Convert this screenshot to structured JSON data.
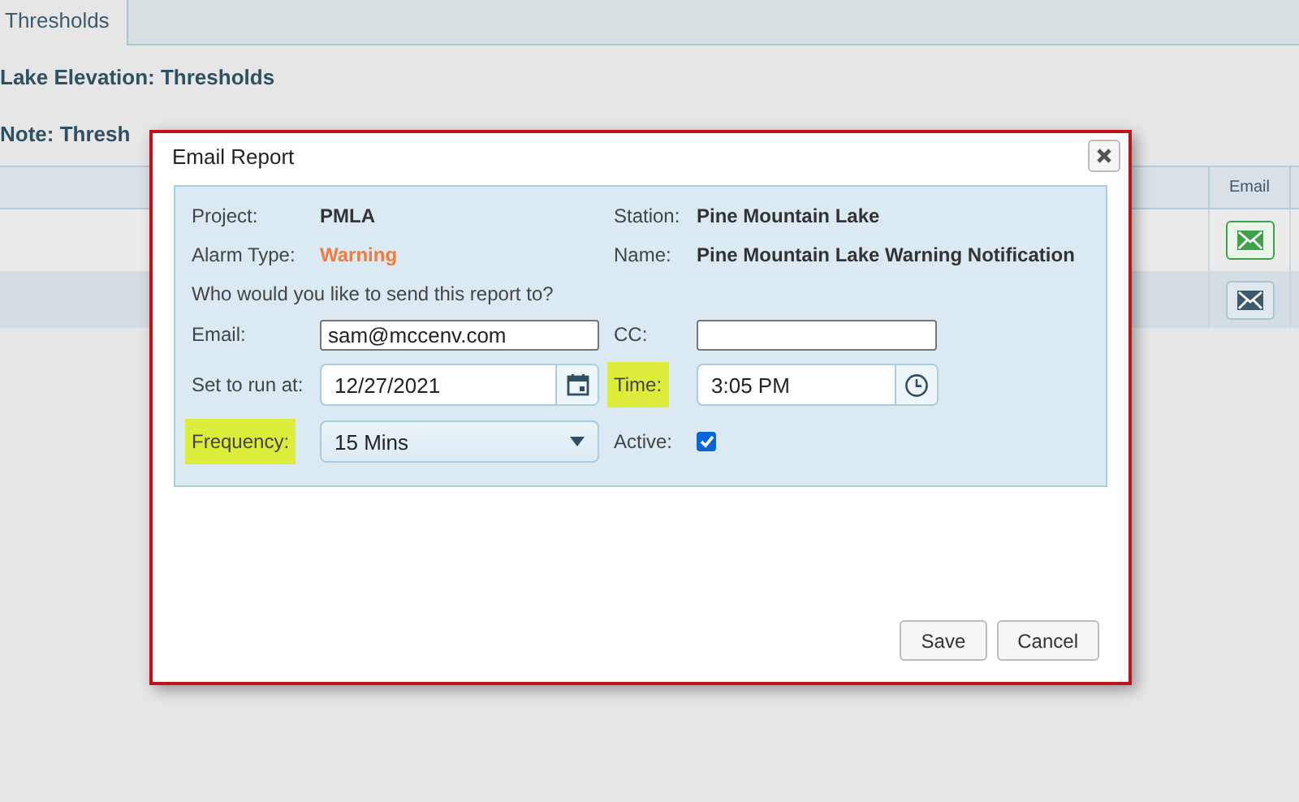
{
  "tabs": [
    {
      "label": "Thresholds",
      "selected": true
    }
  ],
  "heading": "Lake Elevation: Thresholds",
  "note": "Note: Thresh",
  "table": {
    "columns": [
      {
        "label": "Email"
      }
    ],
    "rows": [
      {
        "selected": false,
        "email_highlighted": true
      },
      {
        "selected": true,
        "email_highlighted": false
      }
    ]
  },
  "dialog": {
    "title": "Email Report",
    "project": {
      "label": "Project:",
      "value": "PMLA"
    },
    "station": {
      "label": "Station:",
      "value": "Pine Mountain Lake"
    },
    "alarm_type": {
      "label": "Alarm Type:",
      "value": "Warning"
    },
    "name": {
      "label": "Name:",
      "value": "Pine Mountain Lake Warning Notification"
    },
    "question": "Who would you like to send this report to?",
    "email": {
      "label": "Email:",
      "value": "sam@mccenv.com",
      "highlighted": false
    },
    "cc": {
      "label": "CC:",
      "highlighted": false
    },
    "run_at": {
      "label": "Set to run at:",
      "value": "12/27/2021",
      "highlighted": false
    },
    "time": {
      "label": "Time:",
      "value": "3:05 PM",
      "highlighted": true
    },
    "frequency": {
      "label": "Frequency:",
      "value": "15 Mins",
      "highlighted": true
    },
    "active": {
      "label": "Active:",
      "checked": true
    },
    "buttons": [
      {
        "label": "Save"
      },
      {
        "label": "Cancel"
      }
    ]
  }
}
